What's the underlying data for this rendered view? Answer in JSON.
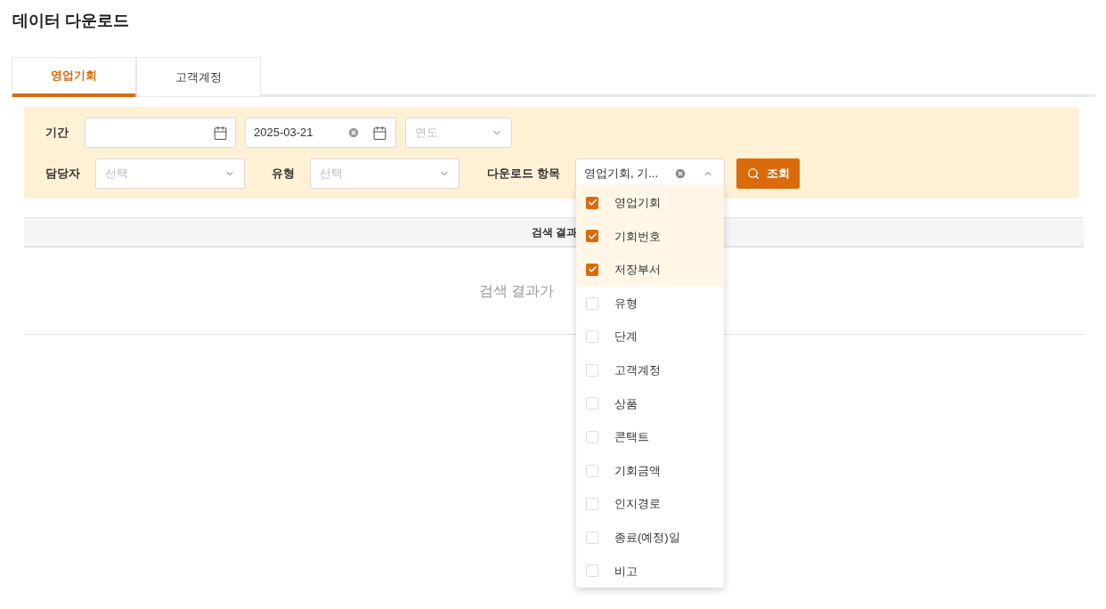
{
  "title": "데이터 다운로드",
  "tabs": [
    {
      "label": "영업기회",
      "selected": true
    },
    {
      "label": "고객계정",
      "selected": false
    }
  ],
  "filters": {
    "period_label": "기간",
    "end_date": {
      "value": "2025-03-21"
    },
    "year": {
      "placeholder": "연도"
    },
    "owner_label": "담당자",
    "owner": {
      "placeholder": "선택"
    },
    "type_label": "유형",
    "type": {
      "placeholder": "선택"
    },
    "items_label": "다운로드 항목",
    "items_value": "영업기회, 기...",
    "search_button": "조회"
  },
  "table": {
    "header": "검색 결과",
    "empty": "검색 결과가"
  },
  "dropdown": [
    {
      "label": "영업기회",
      "checked": true
    },
    {
      "label": "기회번호",
      "checked": true
    },
    {
      "label": "저장부서",
      "checked": true
    },
    {
      "label": "유형",
      "checked": false
    },
    {
      "label": "단계",
      "checked": false
    },
    {
      "label": "고객계정",
      "checked": false
    },
    {
      "label": "상품",
      "checked": false
    },
    {
      "label": "콘택트",
      "checked": false
    },
    {
      "label": "기회금액",
      "checked": false
    },
    {
      "label": "인지경로",
      "checked": false
    },
    {
      "label": "종료(예정)일",
      "checked": false
    },
    {
      "label": "비고",
      "checked": false
    }
  ]
}
